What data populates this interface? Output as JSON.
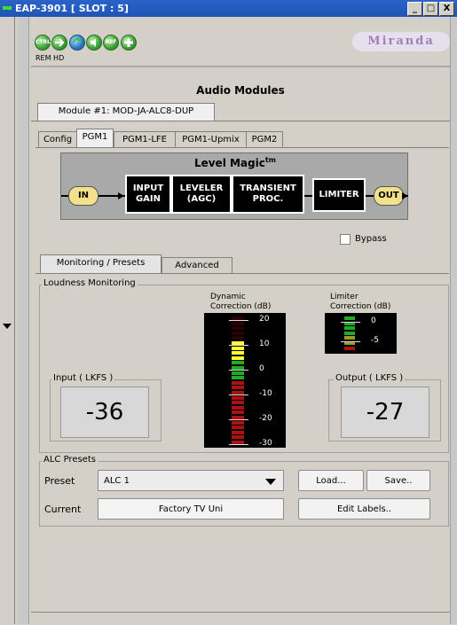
{
  "window": {
    "title": "EAP-3901 [ SLOT : 5]",
    "min_label": "_",
    "max_label": "□",
    "close_label": "X"
  },
  "toolbar": {
    "icons": [
      {
        "name": "ctrl-icon",
        "label": "CTRL"
      },
      {
        "name": "arrow-right-icon",
        "label": ""
      },
      {
        "name": "refresh-icon",
        "label": ""
      },
      {
        "name": "speaker-icon",
        "label": ""
      },
      {
        "name": "ref-icon",
        "label": "REF"
      },
      {
        "name": "plus-icon",
        "label": ""
      }
    ],
    "rem_hd": "REM  HD",
    "brand": "Miranda"
  },
  "audio_modules": {
    "title": "Audio Modules",
    "module_tab": "Module #1: MOD-JA-ALC8-DUP",
    "sub_tabs": [
      "Config",
      "PGM1",
      "PGM1-LFE",
      "PGM1-Upmix",
      "PGM2"
    ],
    "active_sub_tab": "PGM1"
  },
  "level_magic": {
    "title": "Level Magic",
    "tm": "tm",
    "in": "IN",
    "out": "OUT",
    "blocks": [
      "INPUT\nGAIN",
      "LEVELER\n(AGC)",
      "TRANSIENT\nPROC.",
      "LIMITER"
    ],
    "bypass_label": "Bypass",
    "bypass_checked": false
  },
  "monitor_tabs": [
    "Monitoring / Presets",
    "Advanced"
  ],
  "loudness": {
    "group_label": "Loudness Monitoring",
    "dynamic_label": "Dynamic\nCorrection (dB)",
    "limiter_label": "Limiter\nCorrection (dB)",
    "dynamic_ticks": [
      "20",
      "10",
      "0",
      "-10",
      "-20",
      "-30"
    ],
    "limiter_ticks": [
      "0",
      "-5"
    ],
    "input_label": "Input ( LKFS )",
    "input_value": "-36",
    "output_label": "Output ( LKFS )",
    "output_value": "-27",
    "colors": {
      "green": "#22aa22",
      "yellow": "#ffff33",
      "red": "#aa1111",
      "olive": "#9a9a22"
    }
  },
  "alc_presets": {
    "group_label": "ALC Presets",
    "preset_label": "Preset",
    "preset_value": "ALC 1",
    "current_label": "Current",
    "current_value": "Factory TV Uni",
    "load_label": "Load...",
    "save_label": "Save..",
    "edit_labels": "Edit Labels.."
  }
}
